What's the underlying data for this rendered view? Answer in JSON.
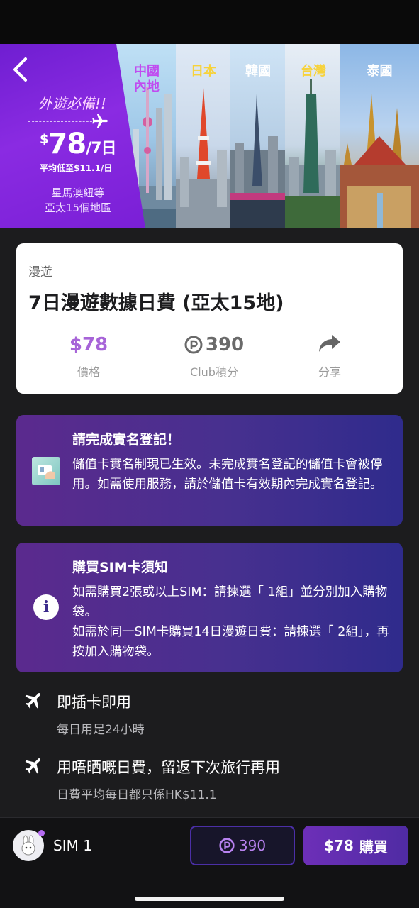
{
  "banner": {
    "tagline": "外遊必備!!",
    "price_symbol": "$",
    "price_value": "78",
    "price_unit": "/7日",
    "avg_price": "平均低至$11.1/日",
    "region_line1": "星馬澳紐等",
    "region_line2": "亞太15個地區",
    "destinations": [
      {
        "label": "中國\n內地",
        "color": "#c04cf0"
      },
      {
        "label": "日本",
        "color": "#f7d23a"
      },
      {
        "label": "韓國",
        "color": "#ffffff"
      },
      {
        "label": "台灣",
        "color": "#f7d23a"
      },
      {
        "label": "泰國",
        "color": "#ffffff"
      }
    ]
  },
  "product": {
    "category": "漫遊",
    "title": "7日漫遊數據日費 (亞太15地)",
    "price_value": "$78",
    "price_label": "價格",
    "club_points_value": "390",
    "club_points_label": "Club積分",
    "share_label": "分享"
  },
  "notice_registration": {
    "heading": "請完成實名登記！",
    "body": "儲值卡實名制現已生效。未完成實名登記的儲值卡會被停用。如需使用服務，請於儲值卡有效期內完成實名登記。"
  },
  "notice_sim": {
    "heading": "購買SIM卡須知",
    "body_line1": "如需購買2張或以上SIM：請揀選「 1組」並分別加入購物袋。",
    "body_line2": "如需於同一SIM卡購買14日漫遊日費：請揀選「 2組」，再按加入購物袋。"
  },
  "features": [
    {
      "title": "即插卡即用",
      "subtitle": "每日用足24小時"
    },
    {
      "title": "用唔晒嘅日費，留返下次旅行再用",
      "subtitle": "日費平均每日都只係HK$11.1"
    }
  ],
  "bottom_bar": {
    "sim_label": "SIM 1",
    "points_button": "390",
    "buy_price": "$78",
    "buy_label": "購買"
  },
  "colors": {
    "accent": "#a764d8",
    "promo_purple": "#8a2be2",
    "notice_gradient_start": "#5b2a8e",
    "notice_gradient_end": "#2f2b8c"
  }
}
